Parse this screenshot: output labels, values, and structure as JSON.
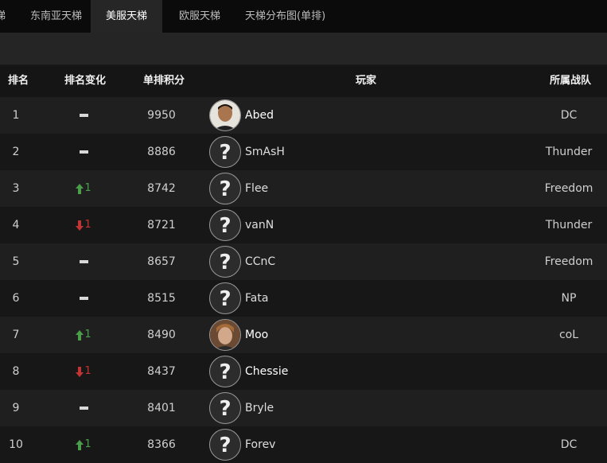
{
  "tabs": [
    {
      "label": "东南亚天梯",
      "active": false
    },
    {
      "label": "美服天梯",
      "active": true
    },
    {
      "label": "欧服天梯",
      "active": false
    },
    {
      "label": "天梯分布图(单排)",
      "active": false
    }
  ],
  "tab_partial": "梯",
  "table": {
    "headers": {
      "rank": "排名",
      "change": "排名变化",
      "score": "单排积分",
      "player": "玩家",
      "team": "所属战队"
    },
    "rows": [
      {
        "rank": "1",
        "change": "same",
        "change_value": "",
        "score": "9950",
        "avatar": "photo-young",
        "player": "Abed",
        "team": "DC"
      },
      {
        "rank": "2",
        "change": "same",
        "change_value": "",
        "score": "8886",
        "avatar": "unknown",
        "player": "SmAsH",
        "team": "Thunder"
      },
      {
        "rank": "3",
        "change": "up",
        "change_value": "1",
        "score": "8742",
        "avatar": "unknown",
        "player": "Flee",
        "team": "Freedom"
      },
      {
        "rank": "4",
        "change": "down",
        "change_value": "1",
        "score": "8721",
        "avatar": "unknown",
        "player": "vanN",
        "team": "Thunder"
      },
      {
        "rank": "5",
        "change": "same",
        "change_value": "",
        "score": "8657",
        "avatar": "unknown",
        "player": "CCnC",
        "team": "Freedom"
      },
      {
        "rank": "6",
        "change": "same",
        "change_value": "",
        "score": "8515",
        "avatar": "unknown",
        "player": "Fata",
        "team": "NP"
      },
      {
        "rank": "7",
        "change": "up",
        "change_value": "1",
        "score": "8490",
        "avatar": "photo-blond",
        "player": "Moo",
        "team": "coL"
      },
      {
        "rank": "8",
        "change": "down",
        "change_value": "1",
        "score": "8437",
        "avatar": "unknown",
        "player": "Chessie",
        "team": ""
      },
      {
        "rank": "9",
        "change": "same",
        "change_value": "",
        "score": "8401",
        "avatar": "unknown",
        "player": "Bryle",
        "team": ""
      },
      {
        "rank": "10",
        "change": "up",
        "change_value": "1",
        "score": "8366",
        "avatar": "unknown",
        "player": "Forev",
        "team": "DC"
      }
    ]
  },
  "colors": {
    "up": "#4a9e4a",
    "down": "#c23333",
    "active_tab": "#262626"
  }
}
